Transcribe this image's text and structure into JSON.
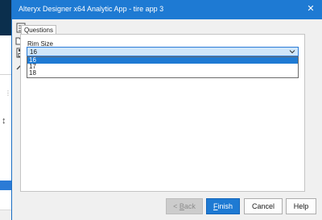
{
  "window": {
    "title": "Alteryx Designer x64 Analytic App - tire app 3",
    "close_glyph": "✕"
  },
  "toolbar": {
    "icons": [
      "app-icon",
      "folder-open-icon",
      "save-icon",
      "wand-icon"
    ]
  },
  "tabs": [
    {
      "label": "Questions",
      "active": true
    }
  ],
  "form": {
    "field_label": "Rim Size",
    "selected_value": "16",
    "options": [
      "16",
      "17",
      "18"
    ],
    "highlighted_option": "16"
  },
  "buttons": {
    "back_prefix": "< ",
    "back_mnemonic": "B",
    "back_rest": "ack",
    "finish_mnemonic": "F",
    "finish_rest": "inish",
    "cancel": "Cancel",
    "help": "Help"
  },
  "background": {
    "dots_glyph": "⋮⋮",
    "arrows_glyph": "↕"
  },
  "colors": {
    "titlebar": "#1e7ad3",
    "accent": "#1e7ad3",
    "combo_selected_bg": "#cfe6fa",
    "dialog_bg": "#f0f0f0"
  }
}
